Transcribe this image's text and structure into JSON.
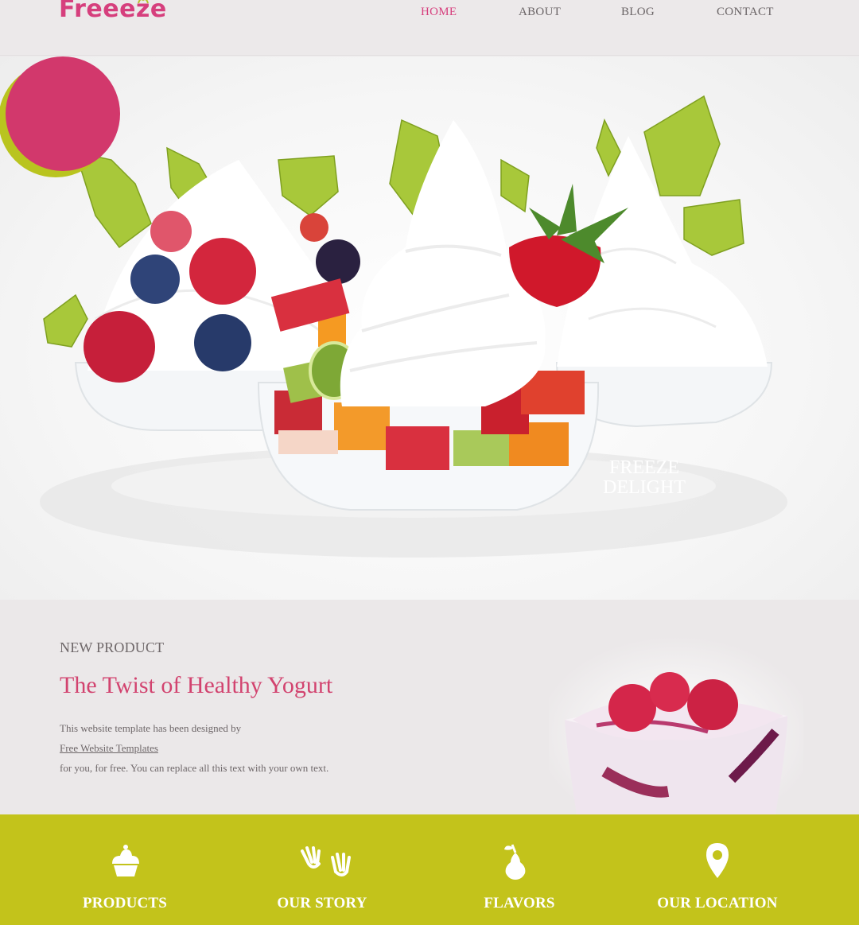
{
  "header": {
    "logo": "Freeeze",
    "nav": [
      {
        "label": "HOME",
        "active": true
      },
      {
        "label": "ABOUT",
        "active": false
      },
      {
        "label": "BLOG",
        "active": false
      },
      {
        "label": "CONTACT",
        "active": false
      }
    ]
  },
  "hero": {
    "badge_line1": "FREEZE",
    "badge_line2": "DELIGHT"
  },
  "product": {
    "kicker": "NEW PRODUCT",
    "headline": "The Twist of Healthy Yogurt",
    "line1": "This website template has been designed by",
    "link": "Free Website Templates",
    "line2": "for you, for free. You can replace all this text with your own text."
  },
  "features": [
    {
      "label": "PRODUCTS",
      "icon": "cupcake-icon"
    },
    {
      "label": "OUR STORY",
      "icon": "hands-icon"
    },
    {
      "label": "FLAVORS",
      "icon": "pear-icon"
    },
    {
      "label": "OUR LOCATION",
      "icon": "map-pin-icon"
    }
  ],
  "colors": {
    "brand_pink": "#d63f7d",
    "band_green": "#c3c31b",
    "background": "#ece9ea"
  }
}
